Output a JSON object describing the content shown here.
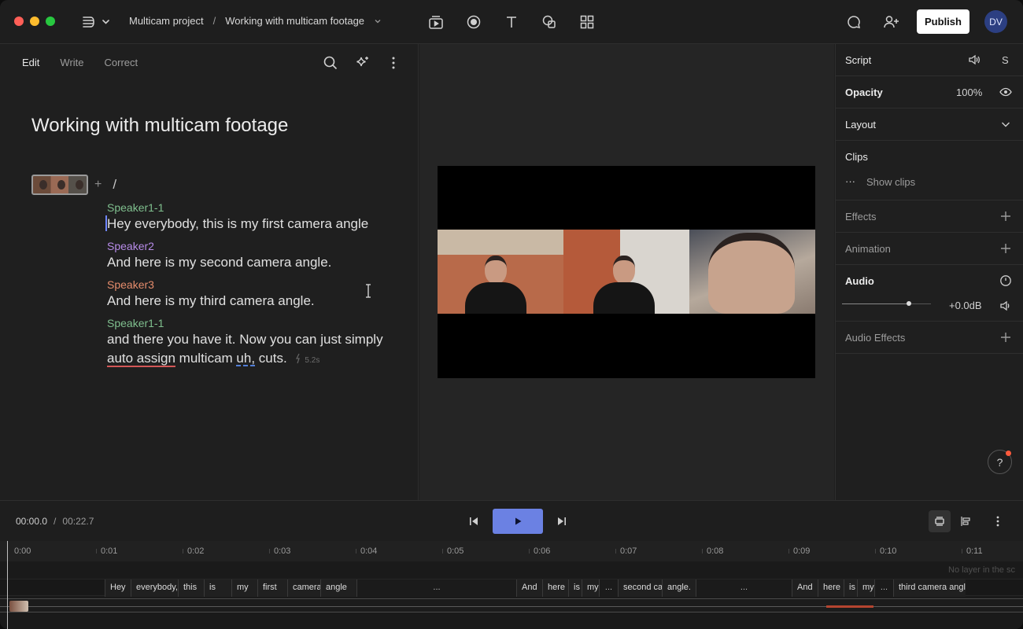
{
  "app": {
    "breadcrumb": {
      "project": "Multicam project",
      "separator": "/",
      "composition": "Working with multicam footage"
    },
    "publish_label": "Publish",
    "avatar_initials": "DV"
  },
  "editor": {
    "tabs": [
      {
        "label": "Edit",
        "active": true
      },
      {
        "label": "Write",
        "active": false
      },
      {
        "label": "Correct",
        "active": false
      }
    ],
    "doc_title": "Working with multicam footage",
    "scene_slash": "/",
    "scene_plus": "+",
    "blocks": [
      {
        "speaker": "Speaker1-1",
        "speaker_color": "#7fbf8e",
        "text": "Hey everybody, this is my first camera angle"
      },
      {
        "speaker": "Speaker2",
        "speaker_color": "#b78be8",
        "text": "And here is my second camera angle."
      },
      {
        "speaker": "Speaker3",
        "speaker_color": "#e58c6c",
        "text": "And here is my third camera angle."
      },
      {
        "speaker": "Speaker1-1",
        "speaker_color": "#7fbf8e",
        "text": "and there you have it. Now you can just simply",
        "line2": {
          "w1": "auto assign",
          "w2": " multicam ",
          "w3": "uh,",
          "w4": " cuts.",
          "pause": "5.2s"
        }
      }
    ]
  },
  "inspector": {
    "script_label": "Script",
    "script_right": "S",
    "opacity_label": "Opacity",
    "opacity_value": "100%",
    "layout_label": "Layout",
    "clips_label": "Clips",
    "show_clips_label": "Show clips",
    "more_dots": "···",
    "effects_label": "Effects",
    "animation_label": "Animation",
    "audio_label": "Audio",
    "audio_gain": "+0.0dB",
    "audio_level": 0.75,
    "audio_effects_label": "Audio Effects",
    "help_label": "?"
  },
  "transport": {
    "current": "00:00.0",
    "separator": "/",
    "total": "00:22.7"
  },
  "timeline": {
    "ticks": [
      "0:00",
      "0:01",
      "0:02",
      "0:03",
      "0:04",
      "0:05",
      "0:06",
      "0:07",
      "0:08",
      "0:09",
      "0:10",
      "0:11"
    ],
    "no_layer_text": "No layer in the sc",
    "words": [
      "Hey",
      "everybody,",
      "this",
      "is",
      "my",
      "first",
      "camera",
      "angle",
      "...",
      "And",
      "here",
      "is",
      "my",
      "...",
      "second camera",
      "angle.",
      "...",
      "And",
      "here",
      "is",
      "my",
      "...",
      "third camera angle"
    ]
  },
  "colors": {
    "accent": "#6b81e3",
    "cursor": "#6f86ff",
    "filler_underline": "#5a8cf0",
    "error_underline": "#d25757",
    "notification_dot": "#ff5a3c"
  }
}
